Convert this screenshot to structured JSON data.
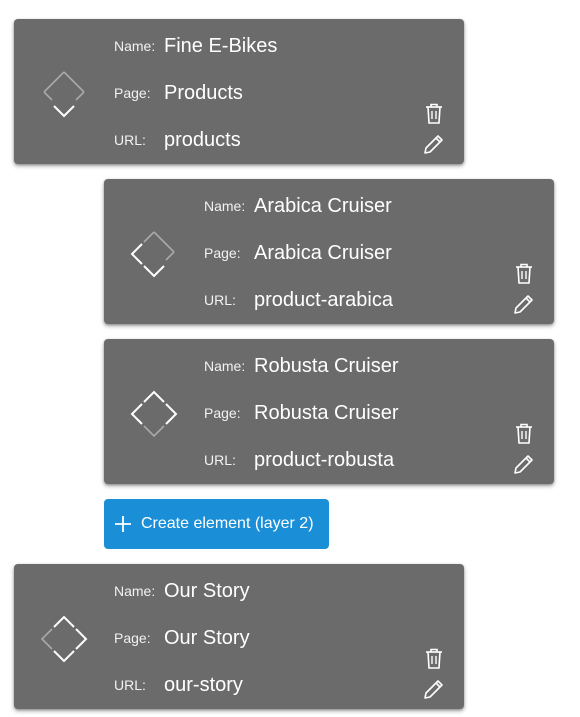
{
  "labels": {
    "name": "Name:",
    "page": "Page:",
    "url": "URL:"
  },
  "items": [
    {
      "name": "Fine E-Bikes",
      "page": "Products",
      "url": "products",
      "layer": 1,
      "nav_icon": "collapse-expand-icon",
      "active_direction": "down"
    },
    {
      "name": "Arabica Cruiser",
      "page": "Arabica Cruiser",
      "url": "product-arabica",
      "layer": 2,
      "nav_icon": "collapse-expand-icon",
      "active_direction": "down-left"
    },
    {
      "name": "Robusta Cruiser",
      "page": "Robusta Cruiser",
      "url": "product-robusta",
      "layer": 2,
      "nav_icon": "collapse-expand-icon",
      "active_direction": "up-left-right"
    },
    {
      "name": "Our Story",
      "page": "Our Story",
      "url": "our-story",
      "layer": 1,
      "nav_icon": "collapse-expand-icon",
      "active_direction": "up-right-down"
    }
  ],
  "create_button": {
    "label": "Create element (layer 2)",
    "icon": "plus-icon",
    "color": "#1a8fd8"
  },
  "colors": {
    "card_bg": "#6b6b6b",
    "text": "#ffffff"
  },
  "actions": {
    "delete_icon": "trash-icon",
    "edit_icon": "pencil-icon"
  }
}
